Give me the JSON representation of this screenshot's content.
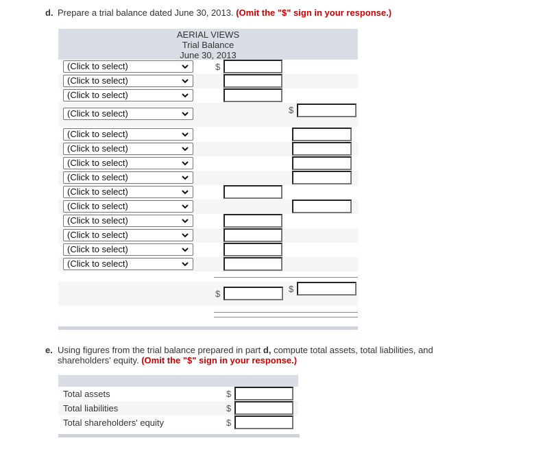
{
  "part_d": {
    "letter": "d.",
    "prompt": "Prepare a trial balance dated June 30, 2013.",
    "note": "(Omit the \"$\" sign in your response.)",
    "table": {
      "company": "AERIAL VIEWS",
      "statement": "Trial Balance",
      "date": "June 30, 2013",
      "currency_symbol": "$",
      "select_placeholder": "(Click to select)",
      "rows": [
        {
          "account": "(Click to select)",
          "debit": "",
          "credit": null
        },
        {
          "account": "(Click to select)",
          "debit": "",
          "credit": null
        },
        {
          "account": "(Click to select)",
          "debit": "",
          "credit": null
        },
        {
          "account": "(Click to select)",
          "debit": null,
          "credit": ""
        },
        {
          "account": "(Click to select)",
          "debit": null,
          "credit": ""
        },
        {
          "account": "(Click to select)",
          "debit": null,
          "credit": ""
        },
        {
          "account": "(Click to select)",
          "debit": null,
          "credit": ""
        },
        {
          "account": "(Click to select)",
          "debit": null,
          "credit": ""
        },
        {
          "account": "(Click to select)",
          "debit": "",
          "credit": null
        },
        {
          "account": "(Click to select)",
          "debit": null,
          "credit": ""
        },
        {
          "account": "(Click to select)",
          "debit": "",
          "credit": null
        },
        {
          "account": "(Click to select)",
          "debit": "",
          "credit": null
        },
        {
          "account": "(Click to select)",
          "debit": "",
          "credit": null
        },
        {
          "account": "(Click to select)",
          "debit": "",
          "credit": null
        }
      ],
      "totals": {
        "debit": "",
        "credit": ""
      }
    }
  },
  "part_e": {
    "letter": "e.",
    "prompt_1": "Using figures from the trial balance prepared in part",
    "prompt_bold": "d,",
    "prompt_2": "compute total assets, total liabilities, and",
    "prompt_line2": "shareholders' equity.",
    "note": "(Omit the \"$\" sign in your response.)",
    "currency_symbol": "$",
    "rows": [
      {
        "label": "Total assets",
        "value": ""
      },
      {
        "label": "Total liabilities",
        "value": ""
      },
      {
        "label": "Total shareholders' equity",
        "value": ""
      }
    ]
  }
}
